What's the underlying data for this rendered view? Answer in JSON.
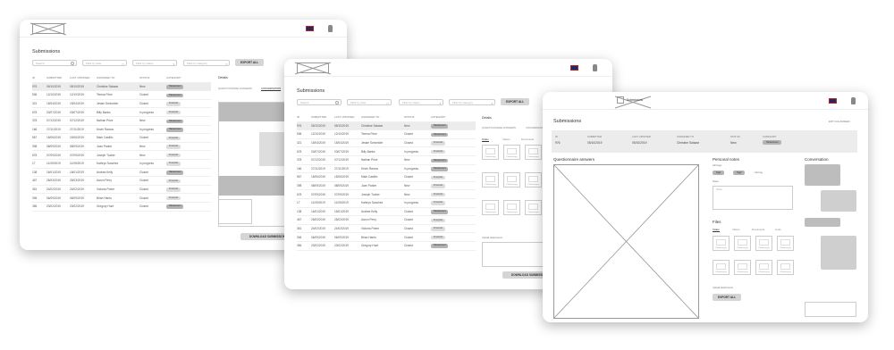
{
  "headers": [
    "ID",
    "SUBMITTED",
    "LAST UPDATED",
    "ASSIGNED TO",
    "STATUS",
    "CATEGORY"
  ],
  "rows": [
    {
      "id": "976",
      "submitted": "05/10/2019",
      "updated": "05/10/2019",
      "assignee": "Christine Salazar",
      "status": "New",
      "category": "Harassment"
    },
    {
      "id": "536",
      "submitted": "12/10/2019",
      "updated": "12/10/2019",
      "assignee": "Teresa Price",
      "status": "Closed",
      "category": "Harassment"
    },
    {
      "id": "321",
      "submitted": "15/04/2019",
      "updated": "15/04/2019",
      "assignee": "Jessie Schneider",
      "status": "Closed",
      "category": "Financial"
    },
    {
      "id": "678",
      "submitted": "03/07/2019",
      "updated": "03/07/2019",
      "assignee": "Billy Banks",
      "status": "In progress",
      "category": "Financial"
    },
    {
      "id": "378",
      "submitted": "07/12/2019",
      "updated": "07/12/2019",
      "assignee": "Nathan Price",
      "status": "New",
      "category": "Harassment"
    },
    {
      "id": "166",
      "submitted": "27/11/2019",
      "updated": "27/11/2019",
      "assignee": "Kevin Ramos",
      "status": "In progress",
      "category": "Harassment"
    },
    {
      "id": "567",
      "submitted": "15/06/2019",
      "updated": "15/06/2019",
      "assignee": "Mark Castillo",
      "status": "Closed",
      "category": "Financial"
    },
    {
      "id": "398",
      "submitted": "08/09/2019",
      "updated": "08/09/2019",
      "assignee": "Joan Parker",
      "status": "New",
      "category": "Financial"
    },
    {
      "id": "678",
      "submitted": "07/09/2019",
      "updated": "07/09/2019",
      "assignee": "Joseph Tucker",
      "status": "New",
      "category": "Financial"
    },
    {
      "id": "17",
      "submitted": "11/09/2019",
      "updated": "11/09/2019",
      "assignee": "Kathryn Sanchez",
      "status": "In progress",
      "category": "Financial"
    },
    {
      "id": "138",
      "submitted": "16/01/2019",
      "updated": "16/01/2019",
      "assignee": "Andrea Kelly",
      "status": "Closed",
      "category": "Harassment"
    },
    {
      "id": "467",
      "submitted": "25/03/2019",
      "updated": "25/03/2019",
      "assignee": "Aaron Perry",
      "status": "Closed",
      "category": "Financial"
    },
    {
      "id": "361",
      "submitted": "24/02/2019",
      "updated": "24/02/2019",
      "assignee": "Victoria Porter",
      "status": "Closed",
      "category": "Financial"
    },
    {
      "id": "306",
      "submitted": "06/09/2019",
      "updated": "06/09/2019",
      "assignee": "Brian Harris",
      "status": "Closed",
      "category": "Financial"
    },
    {
      "id": "356",
      "submitted": "23/02/2019",
      "updated": "23/02/2019",
      "assignee": "Gregory Hunt",
      "status": "Closed",
      "category": "Harassment"
    }
  ],
  "w1": {
    "title": "Submissions",
    "search_placeholder": "Search",
    "filter_date": "Filter by date",
    "filter_status": "Filter by status",
    "filter_category": "Filter by category",
    "export": "EXPORT ALL",
    "details": "Details",
    "tab_answers": "QUESTIONNAIRE ANSWERS",
    "tab_conversation": "CONVERSATION",
    "download": "DOWNLOAD SUBMISSION"
  },
  "w2": {
    "title": "Submissions",
    "search_placeholder": "Search",
    "filter_date": "Filter by date",
    "filter_status": "Filter by status",
    "filter_category": "Filter by category",
    "export": "EXPORT ALL",
    "details": "Details",
    "tab_answers": "QUESTIONNAIRE ANSWERS",
    "tab_conversation": "CONVERSATION",
    "file_tabs": [
      "Intake",
      "Videos",
      "Documents"
    ],
    "thumb_label": "Filename.jpg",
    "upload_label": "Upload attachments",
    "download": "DOWNLOAD SUBMISSION"
  },
  "w3": {
    "app_title": "Submissions",
    "title": "Submissions",
    "exit": "EXIT FULLSCREEN",
    "info_labels": [
      "ID",
      "SUBMITTED",
      "LAST UPDATED",
      "ASSIGNED TO",
      "STATUS",
      "CATEGORY"
    ],
    "info_values": [
      "976",
      "05/10/2019",
      "05/10/2019",
      "Christine Salazar",
      "New",
      "Harassment"
    ],
    "answers": "Questionnaire answers",
    "notes": "Personal notes",
    "edit_tags": "Add tags",
    "tags": [
      "Tag1",
      "Tag2"
    ],
    "add_tag": "Add tag",
    "notes_label": "Notes",
    "notes_placeholder": "Notes",
    "files": "Files",
    "file_tabs": [
      "Intake",
      "Videos",
      "Documents",
      "Links"
    ],
    "thumb_label": "Filename.jpg",
    "upload_label": "Upload attachments",
    "export": "EXPORT ALL",
    "conversation": "Conversation"
  }
}
